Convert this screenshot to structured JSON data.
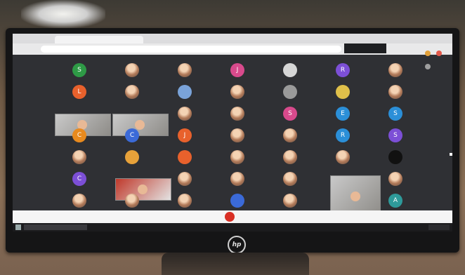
{
  "scene": {
    "monitor_brand": "hp",
    "browser_tab": "",
    "url_text": "",
    "meeting_badge": "",
    "colors": {
      "end_call": "#d93025",
      "screen_bg": "#2f3034"
    }
  },
  "participants": [
    {
      "initial": "S",
      "color": "#2e9a46"
    },
    {
      "initial": "",
      "color": "photo"
    },
    {
      "initial": "",
      "color": "photo"
    },
    {
      "initial": "J",
      "color": "#d84a8c"
    },
    {
      "initial": "",
      "color": "#d6d6d6"
    },
    {
      "initial": "R",
      "color": "#7c4fd6"
    },
    {
      "initial": "",
      "color": "photo"
    },
    {
      "initial": "L",
      "color": "#e8612c"
    },
    {
      "initial": "",
      "color": "photo"
    },
    {
      "initial": "",
      "color": "#7aa3d9"
    },
    {
      "initial": "",
      "color": "photo"
    },
    {
      "initial": "",
      "color": "#9a9a9a"
    },
    {
      "initial": "",
      "color": "#e0c04a"
    },
    {
      "initial": "",
      "color": "photo"
    },
    {
      "initial": "",
      "color": "photo"
    },
    {
      "initial": "",
      "color": "photo"
    },
    {
      "initial": "S",
      "color": "#d84a8c"
    },
    {
      "initial": "E",
      "color": "#2b8fd8"
    },
    {
      "initial": "S",
      "color": "#2b8fd8"
    },
    {
      "initial": "C",
      "color": "#e88a1e"
    },
    {
      "initial": "C",
      "color": "#3b6ad8"
    },
    {
      "initial": "J",
      "color": "#e8612c"
    },
    {
      "initial": "",
      "color": "photo"
    },
    {
      "initial": "",
      "color": "photo"
    },
    {
      "initial": "R",
      "color": "#2b8fd8"
    },
    {
      "initial": "S",
      "color": "#7c4fd6"
    },
    {
      "initial": "",
      "color": "photo"
    },
    {
      "initial": "",
      "color": "#e8a23a"
    },
    {
      "initial": "",
      "color": "#e8612c"
    },
    {
      "initial": "",
      "color": "photo"
    },
    {
      "initial": "",
      "color": "photo"
    },
    {
      "initial": "",
      "color": "photo"
    },
    {
      "initial": "",
      "color": "#111"
    },
    {
      "initial": "C",
      "color": "#7c4fd6"
    },
    {
      "initial": "",
      "color": "photo"
    },
    {
      "initial": "",
      "color": "photo"
    },
    {
      "initial": "",
      "color": "photo"
    },
    {
      "initial": "",
      "color": "photo"
    },
    {
      "initial": "",
      "color": "photo"
    },
    {
      "initial": "",
      "color": "photo"
    },
    {
      "initial": "",
      "color": "photo"
    },
    {
      "initial": "",
      "color": "#3b6ad8"
    },
    {
      "initial": "",
      "color": "photo"
    },
    {
      "initial": "A",
      "color": "#2e9a9a"
    },
    {
      "initial": "A",
      "color": "#e8612c"
    },
    {
      "initial": "",
      "color": "photo"
    },
    {
      "initial": "M",
      "color": "#e8612c"
    }
  ],
  "icons": [
    "end-call-icon",
    "windows-start-icon",
    "search-icon"
  ]
}
